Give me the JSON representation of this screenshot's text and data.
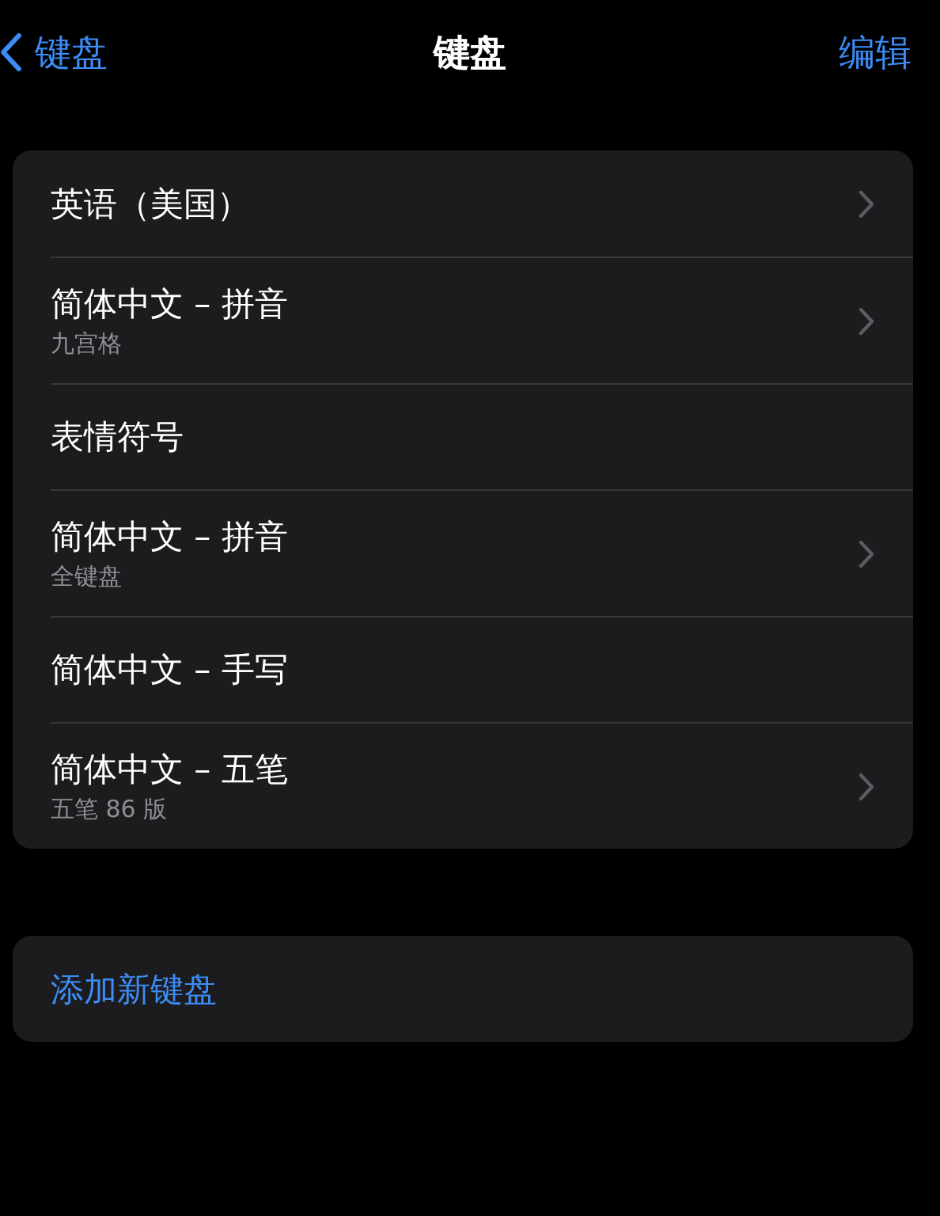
{
  "nav": {
    "back": "键盘",
    "title": "键盘",
    "action": "编辑"
  },
  "keyboards": [
    {
      "title": "英语（美国）",
      "chevron": true
    },
    {
      "title": "简体中文 – 拼音",
      "subtitle": "九宫格",
      "chevron": true
    },
    {
      "title": "表情符号",
      "chevron": false
    },
    {
      "title": "简体中文 – 拼音",
      "subtitle": "全键盘",
      "chevron": true
    },
    {
      "title": "简体中文 – 手写",
      "chevron": false
    },
    {
      "title": "简体中文 – 五笔",
      "subtitle": "五笔 86 版",
      "chevron": true
    }
  ],
  "add_keyboard": "添加新键盘"
}
